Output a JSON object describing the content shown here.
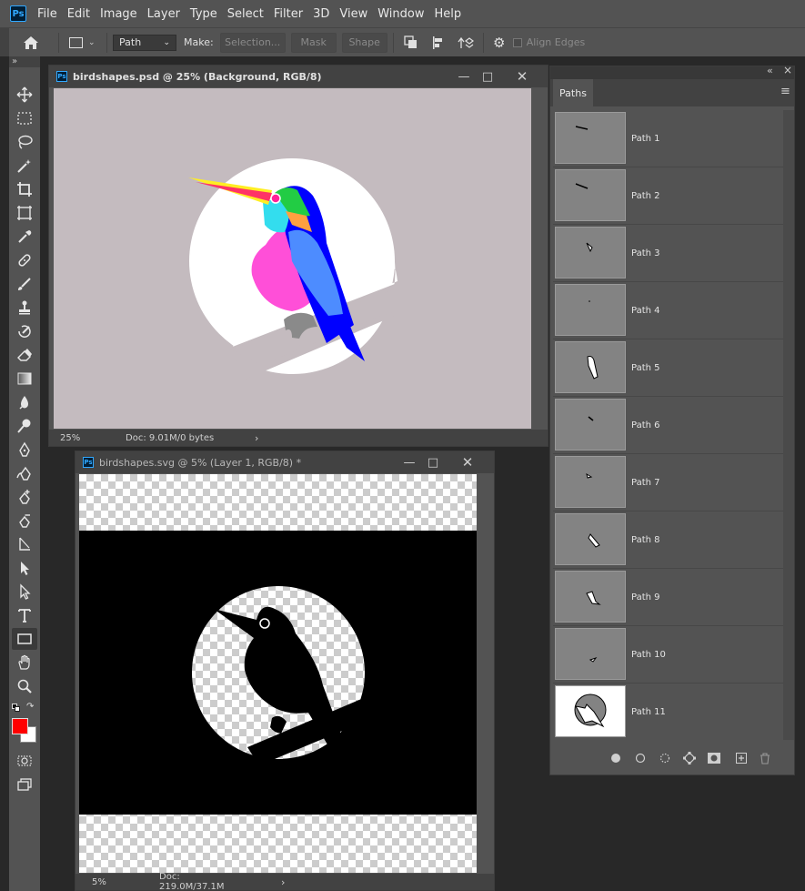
{
  "app": {
    "logo": "Ps",
    "menu": [
      "File",
      "Edit",
      "Image",
      "Layer",
      "Type",
      "Select",
      "Filter",
      "3D",
      "View",
      "Window",
      "Help"
    ]
  },
  "options_bar": {
    "mode_value": "Path",
    "make_label": "Make:",
    "selection_label": "Selection...",
    "mask_label": "Mask",
    "shape_label": "Shape",
    "align_edges_label": "Align Edges"
  },
  "tools": {
    "expand_glyph": "»",
    "foreground_color": "#ff0000",
    "background_color": "#ffffff"
  },
  "doc1": {
    "title": "birdshapes.psd @ 25% (Background, RGB/8)",
    "zoom": "25%",
    "status": "Doc: 9.01M/0 bytes",
    "canvas_color": "#c4bbbf"
  },
  "doc2": {
    "title": "birdshapes.svg @ 5% (Layer 1, RGB/8) *",
    "zoom": "5%",
    "status": "Doc: 219.0M/37.1M"
  },
  "paths_panel": {
    "tab_label": "Paths",
    "collapse_glyph": "«",
    "close_glyph": "×",
    "menu_glyph": "≡",
    "items": [
      {
        "name": "Path 1"
      },
      {
        "name": "Path 2"
      },
      {
        "name": "Path 3"
      },
      {
        "name": "Path 4"
      },
      {
        "name": "Path 5"
      },
      {
        "name": "Path 6"
      },
      {
        "name": "Path 7"
      },
      {
        "name": "Path 8"
      },
      {
        "name": "Path 9"
      },
      {
        "name": "Path 10"
      },
      {
        "name": "Path 11"
      }
    ]
  }
}
